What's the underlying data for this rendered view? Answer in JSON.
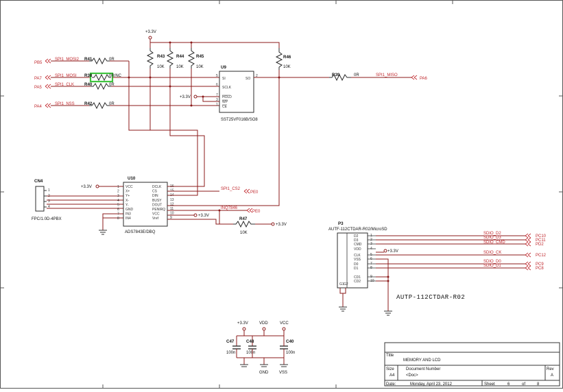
{
  "nets": {
    "pb5": "PB5",
    "pa7": "PA7",
    "pa5": "PA5",
    "pa4": "PA4",
    "pa6": "PA6",
    "spi_mosi2": "SPI1_MOSI2",
    "spi_mosi": "SPI1_MOSI",
    "spi_clk": "SPI1_CLK",
    "spi_nss": "SPI1_NSS",
    "spi_miso": "SPI1_MISO",
    "spi_cs2": "SPI1_CS2",
    "pe0a": "PE0",
    "intx": "INQ7846",
    "pe0b": "PE0",
    "vcc33_top": "+3.3V",
    "vcc33_u9": "+3.3V",
    "vcc33_cn4": "+3.3V",
    "vcc33_u10": "+3.3V",
    "vcc33_r47": "+3.3V",
    "vcc33_p3": "+3.3V",
    "vcc33_pwr": "+3.3V",
    "vdd": "VDD",
    "vcc": "VCC",
    "gnd": "GND",
    "vss": "VSS",
    "sdio_d2": "SDIO_D2",
    "sdio_d3": "SDIO_D3",
    "sdio_cmd": "SDIO_CMD",
    "sdio_ck": "SDIO_CK",
    "sdio_d0": "SDIO_D0",
    "sdio_d1": "SDIO_D1",
    "pc10": "PC10",
    "pc11": "PC11",
    "pd2": "PD2",
    "pc12": "PC12",
    "pc8": "PC8",
    "pc9": "PC9"
  },
  "resistors": {
    "r41": {
      "ref": "R41",
      "value": "0R"
    },
    "r38": {
      "ref": "R38",
      "value": "0R/NC"
    },
    "r40": {
      "ref": "R40",
      "value": "0R"
    },
    "r42": {
      "ref": "R42",
      "value": "0R"
    },
    "r39": {
      "ref": "R39",
      "value": "0R"
    },
    "r43": {
      "ref": "R43",
      "value": "10K"
    },
    "r44": {
      "ref": "R44",
      "value": "10K"
    },
    "r45": {
      "ref": "R45",
      "value": "10K"
    },
    "r46": {
      "ref": "R46",
      "value": "10K"
    },
    "r47": {
      "ref": "R47",
      "value": "10K"
    }
  },
  "u9": {
    "ref": "U9",
    "part": "SST25VF016B/SO8",
    "pins": {
      "si": "SI",
      "so": "SO",
      "sclk": "SCLK",
      "hold": "HOLD",
      "wp": "WP",
      "ce": "CE"
    },
    "nums": {
      "p5": "5",
      "p2": "2",
      "p6": "6",
      "p7": "7",
      "p3": "3",
      "p1": "1"
    }
  },
  "u10": {
    "ref": "U10",
    "part": "ADS7843E/DBQ",
    "left_pins": [
      "VCC",
      "X+",
      "Y+",
      "X-",
      "Y-",
      "GND",
      "IN3",
      "IN4"
    ],
    "left_nums": [
      "1",
      "2",
      "3",
      "4",
      "5",
      "6",
      "7",
      "8"
    ],
    "right_pins": [
      "DCLK",
      "CS",
      "DIN",
      "BUSY",
      "DOUT",
      "PENIRQ",
      "VCC",
      "Vref"
    ],
    "right_nums": [
      "16",
      "15",
      "14",
      "13",
      "12",
      "11",
      "10",
      "9"
    ]
  },
  "cn4": {
    "ref": "CN4",
    "part": "FPC/1.0D-4PBX",
    "nums": [
      "1",
      "2",
      "3",
      "4"
    ]
  },
  "p3": {
    "ref": "P3",
    "part": "AUTF-112CTDAR-R02/MicroSD",
    "label": "AUTP-112CTDAR-R02",
    "pins": [
      "D2",
      "D3",
      "CMD",
      "VDD",
      "CLK",
      "VSS",
      "D0",
      "D1",
      "CD1",
      "CD2"
    ],
    "nums": [
      "1",
      "2",
      "3",
      "4",
      "5",
      "6",
      "7",
      "8",
      "9",
      "10"
    ],
    "gnd_pins": [
      "G1",
      "G2"
    ]
  },
  "caps": {
    "c47": {
      "ref": "C47",
      "value": "100n"
    },
    "c48": {
      "ref": "C48",
      "value": "100n"
    },
    "c40": {
      "ref": "C40",
      "value": "100n"
    }
  },
  "title_block": {
    "title_label": "Title",
    "title": "MEMORY AND LCD",
    "size_label": "Size",
    "size": "A4",
    "docnum_label": "Document Number",
    "docnum": "<Doc>",
    "rev_label": "Rev",
    "rev": "A",
    "date_label": "Date:",
    "date": "Monday, April 23, 2012",
    "sheet_label": "Sheet",
    "sheet": "6",
    "of_label": "of",
    "total": "8"
  },
  "colors": {
    "wire": "#8b1a1a",
    "net_label": "#c0282d",
    "highlight": "#3ec43e"
  }
}
